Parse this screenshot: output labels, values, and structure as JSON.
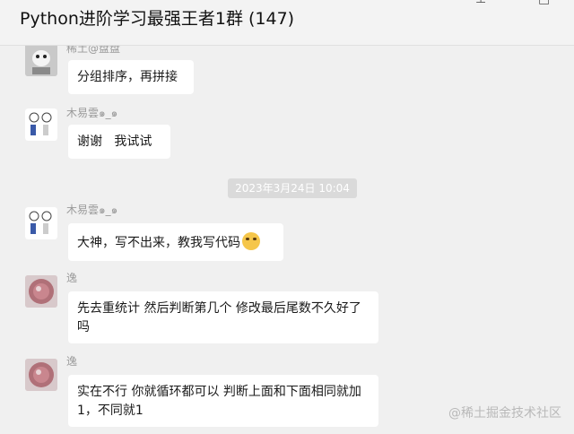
{
  "window": {
    "title": "Python进阶学习最强王者1群 (147)",
    "pin_icon": "pin-icon",
    "minimize_icon": "minimize-icon",
    "maximize_icon": "maximize-icon"
  },
  "messages": [
    {
      "sender": "稀土@盘盘",
      "text": "分组排序，再拼接"
    },
    {
      "sender": "木易雲๑_๑",
      "text": "谢谢   我试试"
    },
    {
      "sender": "木易雲๑_๑",
      "text": "大神，写不出来，教我写代码",
      "emoji": "laugh-cry-emoji"
    },
    {
      "sender": "逸",
      "text": "先去重统计 然后判断第几个 修改最后尾数不久好了吗"
    },
    {
      "sender": "逸",
      "text": "实在不行 你就循环都可以 判断上面和下面相同就加1，不同就1"
    }
  ],
  "timestamp": "2023年3月24日 10:04",
  "watermark": "@稀土掘金技术社区",
  "colors": {
    "background": "#f0f0f0",
    "bubble": "#ffffff",
    "timestamp_bg": "#dadada"
  }
}
